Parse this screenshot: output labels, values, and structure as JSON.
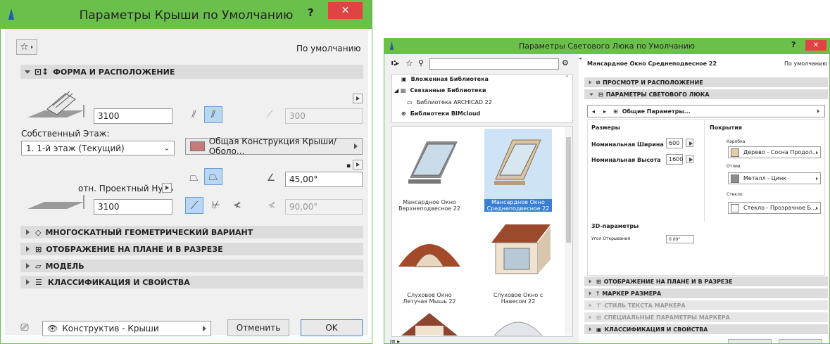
{
  "left": {
    "title": "Параметры Крыши по Умолчанию",
    "help": "?",
    "close": "✕",
    "default_label": "По умолчанию",
    "section_shape": "ФОРМА И РАСПОЛОЖЕНИЕ",
    "height_value": "3100",
    "angle_disabled_value": "300",
    "own_floor_label": "Собственный Этаж:",
    "floor_value": "1. 1-й этаж (Текущий)",
    "structure_value": "Общая Конструкция Крыши/Оболо...",
    "angle_value": "45,00°",
    "ref_label": "отн. Проектный Нуль",
    "ref_value": "3100",
    "angle2_value": "90,00°",
    "sections": [
      "МНОГОСКАТНЫЙ ГЕОМЕТРИЧЕСКИЙ ВАРИАНТ",
      "ОТОБРАЖЕНИЕ НА ПЛАНЕ И В РАЗРЕЗЕ",
      "МОДЕЛЬ",
      "КЛАССИФИКАЦИЯ И СВОЙСТВА"
    ],
    "layer_value": "Конструктив - Крыши",
    "cancel": "Отменить",
    "ok": "OK"
  },
  "right": {
    "title": "Параметры Светового Люка по Умолчанию",
    "help": "?",
    "close": "✕",
    "lib_items": [
      "Вложенная Библиотека",
      "Связанные Библиотеки",
      "Библиотека ARCHICAD 22",
      "Библиотеки BIMcloud"
    ],
    "thumbs": [
      "Мансардное Окно Верхнеподвесное 22",
      "Мансардное Окно Среднеподвесное 22",
      "Слуховое Окно Летучая Мышь 22",
      "Слуховое Окно с Навесом 22"
    ],
    "object_name": "Мансардное Окно Среднеподвесное 22",
    "default_label": "По умолчанию",
    "section_view": "ПРОСМОТР И РАСПОЛОЖЕНИЕ",
    "section_params": "ПАРАМЕТРЫ СВЕТОВОГО ЛЮКА",
    "nav_value": "Общие Параметры...",
    "sizes_label": "Размеры",
    "width_label": "Номинальная Ширина",
    "width_value": "600",
    "height_label": "Номинальная Высота",
    "height_value": "1600",
    "coverings_label": "Покрытия",
    "box_label": "Коробка",
    "box_value": "Дерево - Сосна Продол...",
    "frame_label": "Отлив",
    "frame_value": "Металл - Цинк",
    "glass_label": "Стекло",
    "glass_value": "Стекло - Прозрачное Б...",
    "params3d_label": "3D-параметры",
    "opening_label": "Угол Открывания",
    "opening_value": "0.00°",
    "sections": [
      "ОТОБРАЖЕНИЕ НА ПЛАНЕ И В РАЗРЕЗЕ",
      "МАРКЕР РАЗМЕРА",
      "СТИЛЬ ТЕКСТА МАРКЕРА",
      "СПЕЦИАЛЬНЫЕ ПАРАМЕТРЫ МАРКЕРА",
      "КЛАССИФИКАЦИЯ И СВОЙСТВА"
    ],
    "colors": {
      "box": "#e7c9a3",
      "frame": "#8c8c8c",
      "glass": "#ffffff"
    }
  },
  "colors": {
    "titlebar": "#6bc04b",
    "close": "#e04343",
    "section": "#dcdcdc",
    "highlight": "#b8d7f3"
  }
}
